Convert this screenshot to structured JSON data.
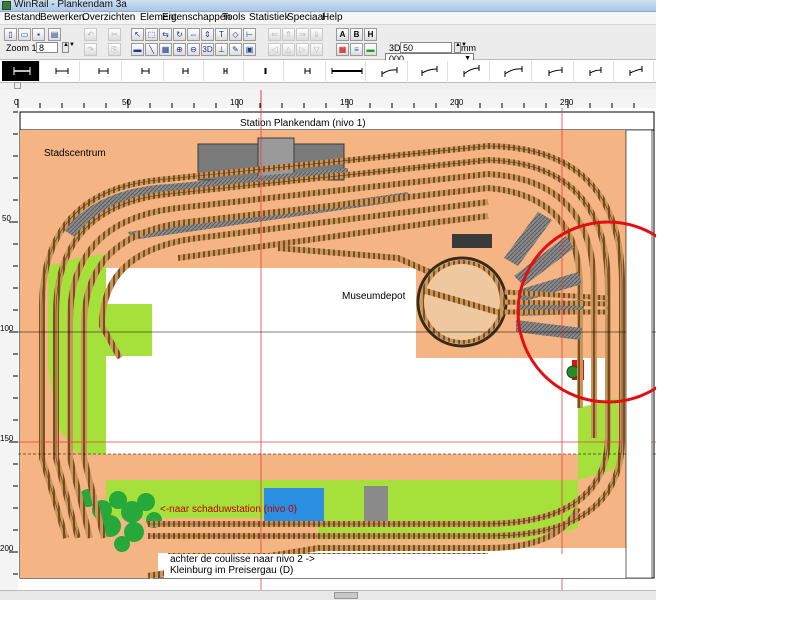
{
  "window": {
    "title": "WinRail - Plankendam 3a"
  },
  "menu": [
    "Bestand",
    "Bewerken",
    "Overzichten",
    "Element",
    "Eigenschappen",
    "Tools",
    "Statistiek",
    "Speciaal",
    "Help"
  ],
  "toolbar": {
    "zoom_label": "Zoom 1:",
    "zoom_value": "8",
    "layer_select": "000",
    "d3_label": "3D:",
    "d3_value": "50",
    "d3_unit": "mm",
    "text_buttons": [
      "A",
      "B",
      "H"
    ]
  },
  "ruler": {
    "h_ticks": [
      "0",
      "50",
      "100",
      "150",
      "200",
      "250"
    ],
    "v_ticks": [
      "50",
      "100",
      "150",
      "200"
    ]
  },
  "layout": {
    "title": "Station Plankendam (nivo 1)",
    "labels": {
      "stadscentrum": "Stadscentrum",
      "museumdepot": "Museumdepot",
      "schaduw": "<-naar schaduwstation (nivo 0)",
      "coulisse": "achter de coulisse  naar nivo 2 ->",
      "kleinburg": "Kleinburg im Preisergau (D)"
    }
  },
  "colors": {
    "baseboard": "#f4b483",
    "grass": "#a6e03a",
    "water": "#2a8fe0",
    "annotation_circle": "#e01010",
    "guide_line": "#e04040",
    "selected_tracktype": "#000000"
  }
}
